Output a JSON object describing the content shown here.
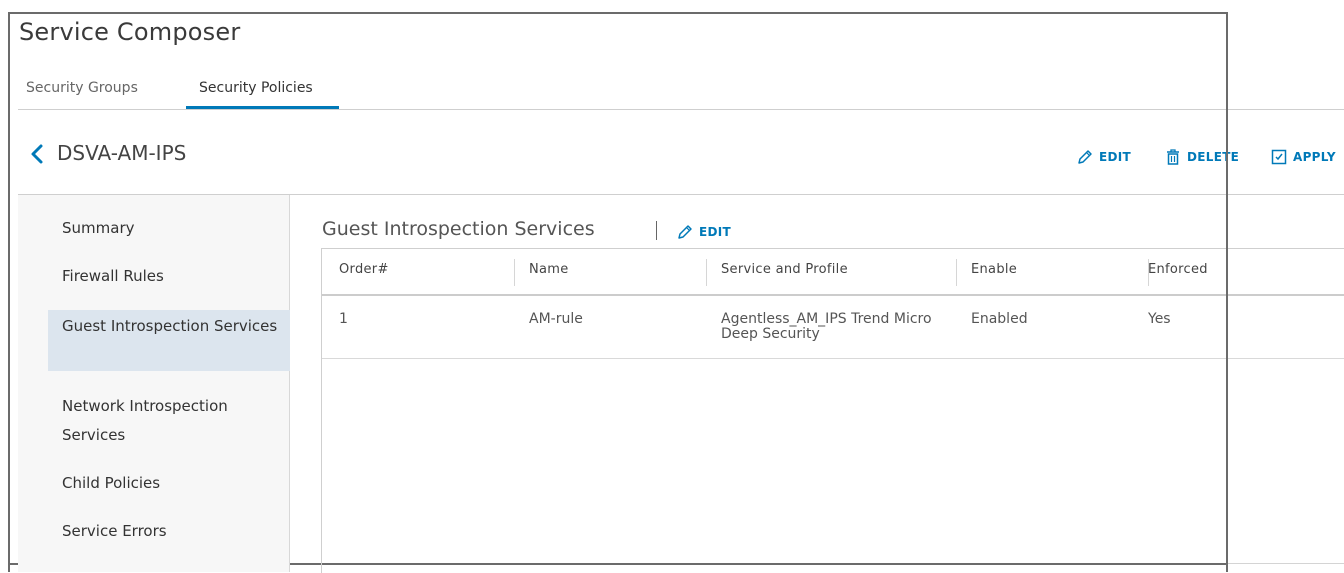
{
  "app": {
    "title": "Service Composer"
  },
  "tabs": [
    {
      "label": "Security Groups",
      "active": false
    },
    {
      "label": "Security Policies",
      "active": true
    }
  ],
  "policy": {
    "name": "DSVA-AM-IPS"
  },
  "actions": {
    "edit": "EDIT",
    "delete": "DELETE",
    "apply": "APPLY"
  },
  "nav": {
    "items": [
      {
        "label": "Summary",
        "active": false
      },
      {
        "label": "Firewall Rules",
        "active": false
      },
      {
        "label": "Guest Introspection Services",
        "active": true
      },
      {
        "label": "Network Introspection Services",
        "active": false
      },
      {
        "label": "Child Policies",
        "active": false
      },
      {
        "label": "Service Errors",
        "active": false
      }
    ]
  },
  "section": {
    "title": "Guest Introspection Services",
    "edit_label": "EDIT"
  },
  "table": {
    "columns": [
      "Order#",
      "Name",
      "Service and Profile",
      "Enable",
      "Enforced"
    ],
    "rows": [
      {
        "order": "1",
        "name": "AM-rule",
        "service_profile": "Agentless_AM_IPS Trend Micro Deep Security",
        "enable": "Enabled",
        "enforced": "Yes"
      }
    ]
  },
  "colors": {
    "accent": "#0079b8",
    "nav_active_bg": "#dce5ee",
    "nav_bg": "#f7f7f7"
  },
  "icons": {
    "back": "chevron-left-icon",
    "edit": "pencil-icon",
    "delete": "trash-icon",
    "apply": "apply-doc-icon"
  }
}
